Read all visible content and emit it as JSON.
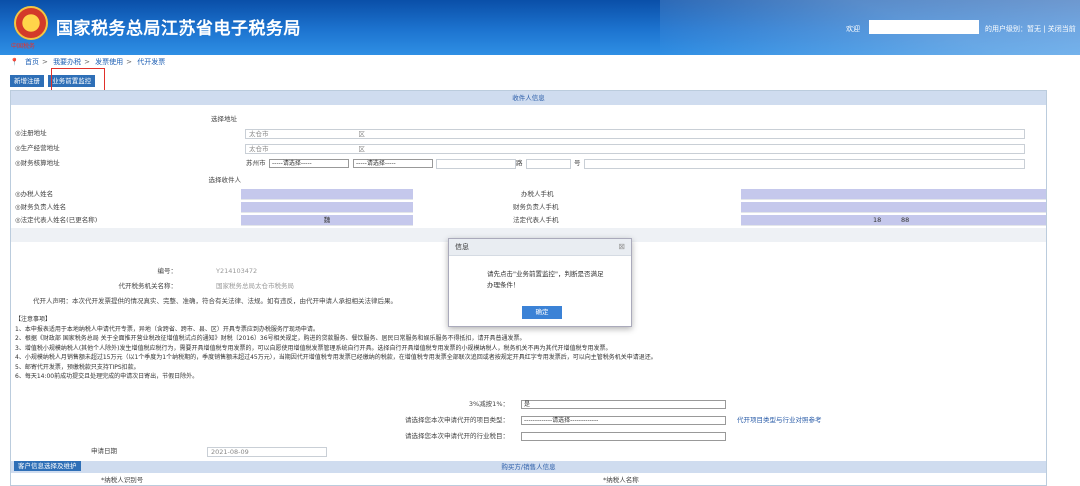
{
  "header": {
    "title": "国家税务总局江苏省电子税务局",
    "emblem_caption": "中国税务",
    "welcome": "欢迎",
    "user_info": "的用户级别：暂无 | 关闭当前"
  },
  "breadcrumb": [
    "首页",
    "我要办税",
    "发票使用",
    "代开发票"
  ],
  "buttons": {
    "new_register": "新增注册",
    "business_check": "业务前置监控"
  },
  "colors": {
    "header_blue": "#1d74d0",
    "section_head": "#cfdcef",
    "purple_cell": "#c5c8ec",
    "ok_button": "#3b82d6",
    "highlight_red": "#e0302a"
  },
  "section_payee": "收件人信息",
  "form": {
    "select_address": "选择地址",
    "registered_address": {
      "label": "◎注册地址",
      "city": "太仓市",
      "district": "区"
    },
    "production_address": {
      "label": "◎生产经营地址",
      "city": "太仓市",
      "district": "区"
    },
    "finance_address": {
      "label": "◎财务核算地址",
      "city": "苏州市",
      "sel1": "-----请选择-----",
      "sel2": "-----请选择-----",
      "road": "路",
      "num": "号"
    },
    "select_payee": "选择收件人",
    "handler_name": "◎办税人姓名",
    "handler_phone": "办税人手机",
    "finance_name": "◎财务负责人姓名",
    "finance_phone": "财务负责人手机",
    "legal_name": "◎法定代表人姓名(已更名称)",
    "legal_name_val": "魏",
    "legal_phone": "法定代表人手机",
    "legal_phone_val_a": "18",
    "legal_phone_val_b": "88",
    "serial_label": "编号：",
    "serial_value": "Y214103472",
    "tax_office_label": "代开税务机关名称：",
    "tax_office_value": "国家税务总局太仓市税务局",
    "declaration": "代开人声明：本次代开发票提供的情况真实、完整、准确，符合有关法律、法规。如有违反，由代开申请人承担相关法律后果。",
    "rate_label": "3%减按1%：",
    "rate_value": "是",
    "project_type_label": "请选择您本次申请代开的项目类型：",
    "project_type_value": "-------------请选择-------------",
    "project_link": "代开项目类型与行业对照参考",
    "industry_label": "请选择您本次申请代开的行业税目：",
    "apply_date_label": "申请日期",
    "apply_date_value": "2021-08-09",
    "buyer_button": "客户信息选择及维护",
    "buyer_section": "购买方/销售人信息",
    "buyer_id_label": "*纳税人识别号",
    "buyer_name_label": "*纳税人名称"
  },
  "notes": {
    "title": "【注意事项】",
    "items": [
      "1、本申报表适用于本地纳税人申请代开专票，异地（含跨省、跨市、县、区）开具专票应到办税服务厅现场申请。",
      "2、根据《财政部 国家税务总局 关于全面推开营业税改征增值税试点的通知》财税〔2016〕36号相关规定，购进的贷款服务、餐饮服务、居民日常服务和娱乐服务不得抵扣，请开具普通发票。",
      "3、增值税小规模纳税人(其他个人除外)发生增值税应税行为，需要开具增值税专用发票的，可以自愿使用增值税发票管理系统自行开具。选择自行开具增值税专用发票的小规模纳税人，税务机关不再为其代开增值税专用发票。",
      "4、小规模纳税人月销售额未超过15万元（以1个季度为1个纳税期的，季度销售额未超过45万元），当期因代开增值税专用发票已经缴纳的税款，在增值税专用发票全部联次追回或者按规定开具红字专用发票后，可以向主管税务机关申请退还。",
      "5、邮寄代开发票，预缴税款只支持TIPS扣款。",
      "6、每天14:00前成功提交且处理完成的申请次日寄出，节假日除外。"
    ]
  },
  "dialog": {
    "title": "信息",
    "message": "请先点击\"业务前置监控\"，判断是否满足办理条件！",
    "ok": "确定",
    "close": "⊠"
  }
}
